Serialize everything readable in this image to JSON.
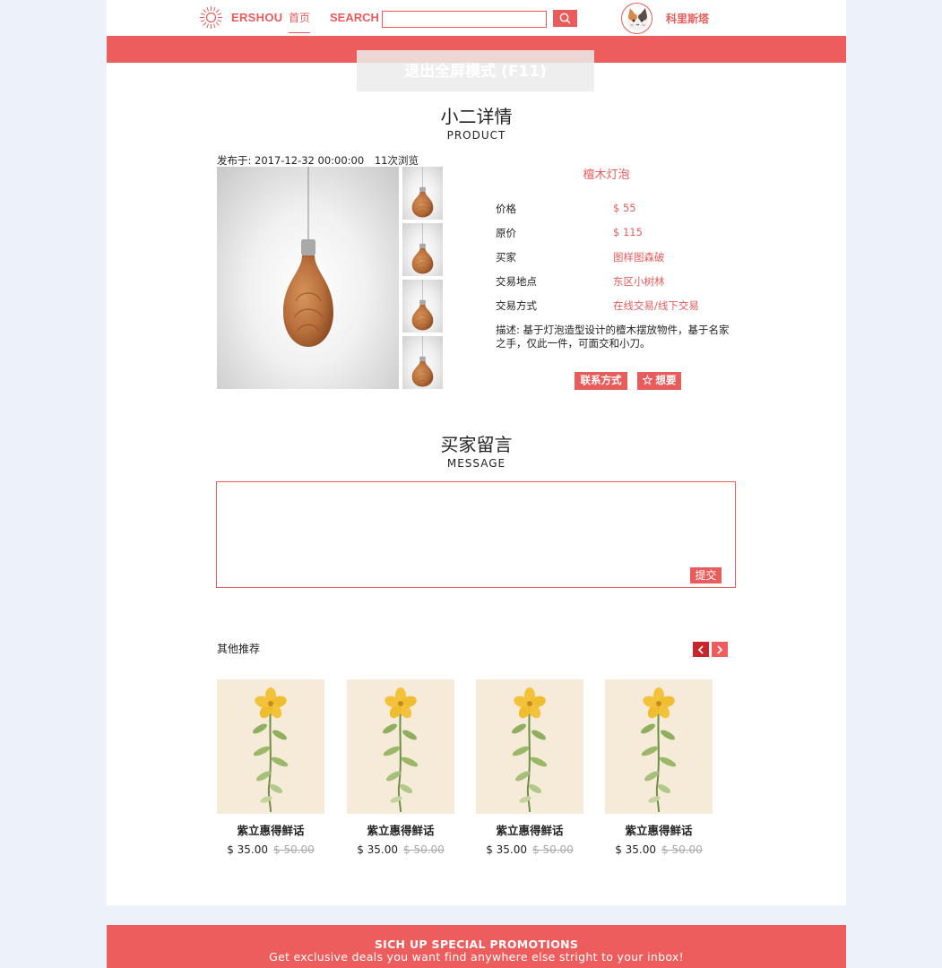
{
  "header": {
    "logo_text": "ERSHOU",
    "nav_home": "首页",
    "search_label": "SEARCH",
    "search_value": "",
    "username": "科里斯塔",
    "fullscreen_tip": "退出全屏模式 (F11)"
  },
  "product_section": {
    "title": "小二详情",
    "subtitle": "PRODUCT",
    "published": "发布于: 2017-12-32 00:00:00",
    "views": "11次浏览",
    "name": "檀木灯泡",
    "attributes": [
      {
        "label": "价格",
        "value": "$ 55"
      },
      {
        "label": "原价",
        "value": "$ 115"
      },
      {
        "label": "买家",
        "value": "图样图森破"
      },
      {
        "label": "交易地点",
        "value": "东区小树林"
      },
      {
        "label": "交易方式",
        "value": "在线交易/线下交易"
      }
    ],
    "description": "描述: 基于灯泡造型设计的檀木摆放物件，基于名家之手，仅此一件，可面交和小刀。",
    "contact_button": "联系方式",
    "want_button": "☆ 想要"
  },
  "message_section": {
    "title": "买家留言",
    "subtitle": "MESSAGE",
    "textarea_value": "",
    "submit_button": "提交"
  },
  "recommend": {
    "title": "其他推荐",
    "items": [
      {
        "name": "紫立惠得鲜话",
        "price": "$ 35.00",
        "old_price": "$ 50.00"
      },
      {
        "name": "紫立惠得鲜话",
        "price": "$ 35.00",
        "old_price": "$ 50.00"
      },
      {
        "name": "紫立惠得鲜话",
        "price": "$ 35.00",
        "old_price": "$ 50.00"
      },
      {
        "name": "紫立惠得鲜话",
        "price": "$ 35.00",
        "old_price": "$ 50.00"
      }
    ]
  },
  "footer": {
    "headline": "SICH UP SPECIAL PROMOTIONS",
    "text": "Get exclusive deals you want find anywhere else stright to your inbox!"
  },
  "colors": {
    "accent": "#e85c5c",
    "band": "#ee5d5d",
    "background": "#edf1f8",
    "arrow_prev": "#c9262c"
  }
}
